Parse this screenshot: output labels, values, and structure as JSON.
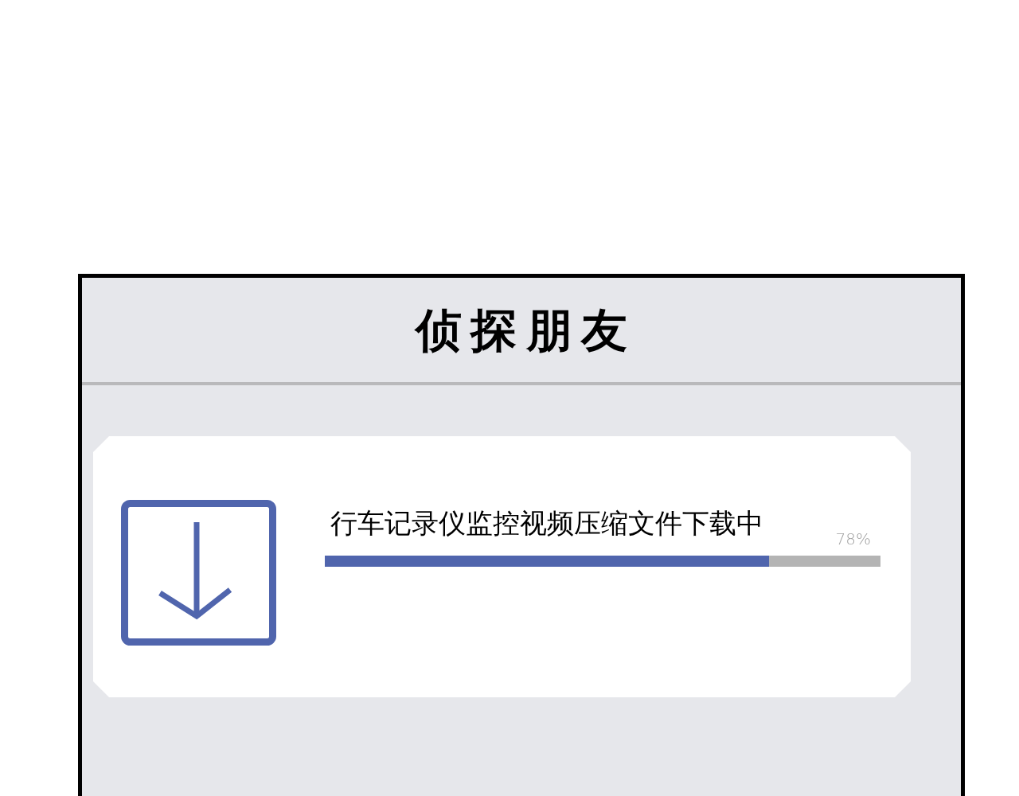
{
  "window": {
    "title": "侦探朋友"
  },
  "download": {
    "label": "行车记录仪监控视频压缩文件下载中",
    "percent": "78%",
    "level": 0.8
  }
}
